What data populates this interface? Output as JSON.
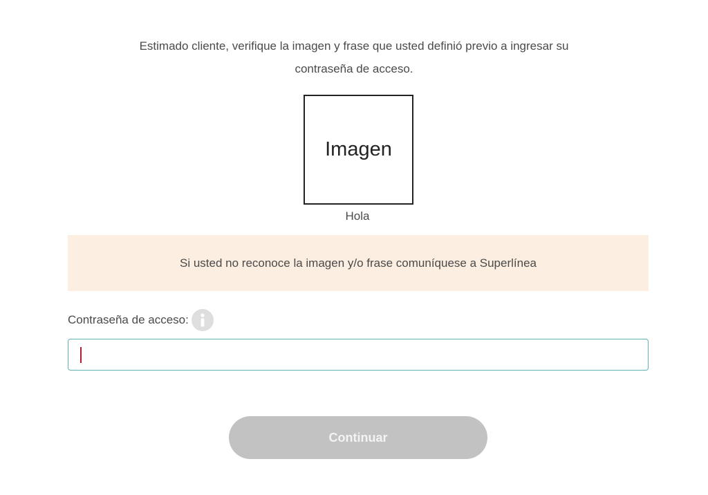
{
  "intro": {
    "line1": "Estimado cliente, verifique la imagen y frase que usted definió previo a ingresar su",
    "line2": "contraseña de acceso."
  },
  "security_image": {
    "label": "Imagen",
    "phrase": "Hola"
  },
  "warning": {
    "text": "Si usted no reconoce la imagen y/o frase comuníquese a Superlínea"
  },
  "password_field": {
    "label": "Contraseña de acceso:",
    "value": "",
    "placeholder": "",
    "help_icon": "info-icon"
  },
  "actions": {
    "continue_label": "Continuar"
  },
  "colors": {
    "banner_bg": "#fcefe2",
    "input_border": "#5fb3b3",
    "caret": "#b01c2e",
    "button_disabled_bg": "#c2c2c2"
  }
}
